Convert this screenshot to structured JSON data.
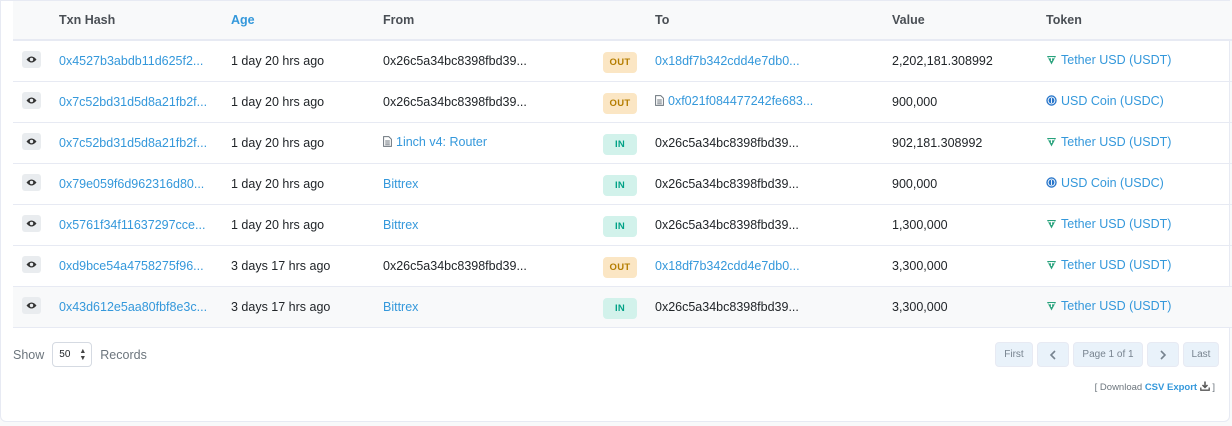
{
  "headers": {
    "txn_hash": "Txn Hash",
    "age": "Age",
    "from": "From",
    "to": "To",
    "value": "Value",
    "token": "Token"
  },
  "rows": [
    {
      "hash": "0x4527b3abdb11d625f2...",
      "age": "1 day 20 hrs ago",
      "from": "0x26c5a34bc8398fbd39...",
      "from_link": false,
      "from_contract": false,
      "dir": "OUT",
      "to": "0x18df7b342cdd4e7db0...",
      "to_link": true,
      "to_contract": false,
      "value": "2,202,181.308992",
      "token": "Tether USD (USDT)",
      "token_kind": "usdt"
    },
    {
      "hash": "0x7c52bd31d5d8a21fb2f...",
      "age": "1 day 20 hrs ago",
      "from": "0x26c5a34bc8398fbd39...",
      "from_link": false,
      "from_contract": false,
      "dir": "OUT",
      "to": "0xf021f084477242fe683...",
      "to_link": true,
      "to_contract": true,
      "value": "900,000",
      "token": "USD Coin (USDC)",
      "token_kind": "usdc"
    },
    {
      "hash": "0x7c52bd31d5d8a21fb2f...",
      "age": "1 day 20 hrs ago",
      "from": "1inch v4: Router",
      "from_link": true,
      "from_contract": true,
      "dir": "IN",
      "to": "0x26c5a34bc8398fbd39...",
      "to_link": false,
      "to_contract": false,
      "value": "902,181.308992",
      "token": "Tether USD (USDT)",
      "token_kind": "usdt"
    },
    {
      "hash": "0x79e059f6d962316d80...",
      "age": "1 day 20 hrs ago",
      "from": "Bittrex",
      "from_link": true,
      "from_contract": false,
      "dir": "IN",
      "to": "0x26c5a34bc8398fbd39...",
      "to_link": false,
      "to_contract": false,
      "value": "900,000",
      "token": "USD Coin (USDC)",
      "token_kind": "usdc"
    },
    {
      "hash": "0x5761f34f11637297cce...",
      "age": "1 day 20 hrs ago",
      "from": "Bittrex",
      "from_link": true,
      "from_contract": false,
      "dir": "IN",
      "to": "0x26c5a34bc8398fbd39...",
      "to_link": false,
      "to_contract": false,
      "value": "1,300,000",
      "token": "Tether USD (USDT)",
      "token_kind": "usdt"
    },
    {
      "hash": "0xd9bce54a4758275f96...",
      "age": "3 days 17 hrs ago",
      "from": "0x26c5a34bc8398fbd39...",
      "from_link": false,
      "from_contract": false,
      "dir": "OUT",
      "to": "0x18df7b342cdd4e7db0...",
      "to_link": true,
      "to_contract": false,
      "value": "3,300,000",
      "token": "Tether USD (USDT)",
      "token_kind": "usdt"
    },
    {
      "hash": "0x43d612e5aa80fbf8e3c...",
      "age": "3 days 17 hrs ago",
      "from": "Bittrex",
      "from_link": true,
      "from_contract": false,
      "dir": "IN",
      "to": "0x26c5a34bc8398fbd39...",
      "to_link": false,
      "to_contract": false,
      "value": "3,300,000",
      "token": "Tether USD (USDT)",
      "token_kind": "usdt"
    }
  ],
  "icons": {
    "view": "eye-icon",
    "contract": "file-icon",
    "usdt": "tether-icon",
    "usdc": "usdc-icon",
    "download": "download-icon"
  },
  "colors": {
    "link": "#3498db",
    "out_bg": "#fbe6c4",
    "out_fg": "#b47d00",
    "in_bg": "#d2f2eb",
    "in_fg": "#00a186",
    "usdt": "#26a17b",
    "usdc": "#2775ca"
  },
  "footer": {
    "show_label": "Show",
    "page_size": "50",
    "records_label": "Records",
    "first": "First",
    "page_info": "Page 1 of 1",
    "last": "Last",
    "download_prefix": "[ Download",
    "csv_export": "CSV Export",
    "download_suffix": "]"
  }
}
